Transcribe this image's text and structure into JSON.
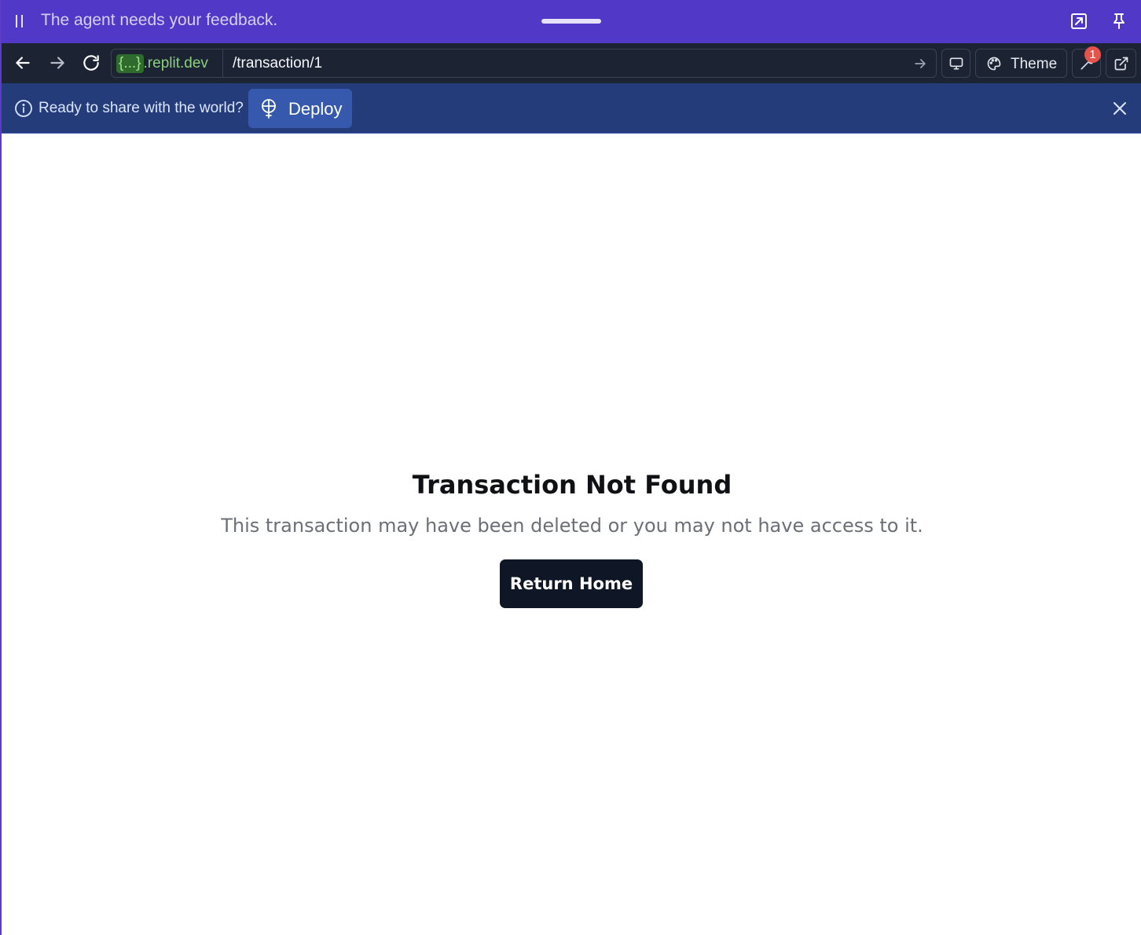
{
  "agent_bar": {
    "message": "The agent needs your feedback.",
    "icons": [
      "pause-icon",
      "drag-handle",
      "pop-out-icon",
      "pin-icon"
    ]
  },
  "browser": {
    "url_host_token": "{...}",
    "url_host_domain": ".replit.dev",
    "url_path": "/transaction/1",
    "theme_label": "Theme",
    "devtools_badge": "1"
  },
  "banner": {
    "text": "Ready to share with the world?",
    "deploy_label": "Deploy"
  },
  "page": {
    "title": "Transaction Not Found",
    "subtitle": "This transaction may have been deleted or you may not have access to it.",
    "return_label": "Return Home"
  },
  "colors": {
    "agent_bar": "#5238c6",
    "toolbar": "#1c2333",
    "banner": "#243d7a",
    "deploy_button": "#3759ad",
    "primary_button": "#0f1626"
  }
}
